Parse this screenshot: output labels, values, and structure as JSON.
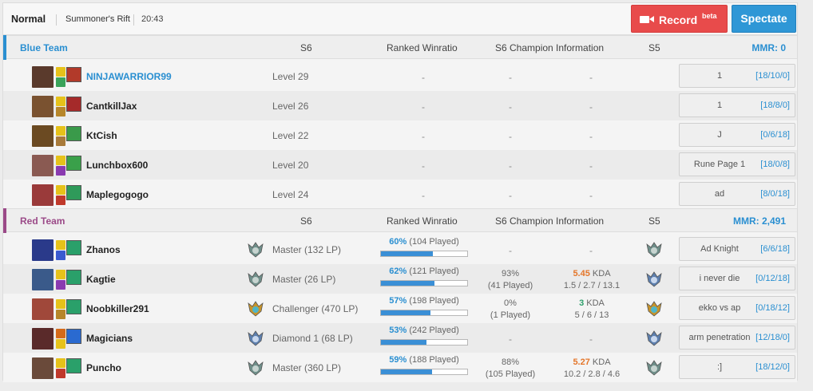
{
  "header": {
    "mode": "Normal",
    "map": "Summoner's Rift",
    "duration": "20:43",
    "record_label": "Record",
    "record_badge": "beta",
    "spectate_label": "Spectate"
  },
  "blue": {
    "name": "Blue Team",
    "columns": {
      "s6": "S6",
      "ranked": "Ranked Winratio",
      "champinfo": "S6 Champion Information",
      "s5": "S5"
    },
    "mmr": "MMR: 0",
    "color": "#2a8fd1",
    "players": [
      {
        "name": "NINJAWARRIOR99",
        "level": "Level 29",
        "ranked": "-",
        "champ_wr": "-",
        "kda": "-",
        "rune_page": "1",
        "rune_kda": "[18/10/0]",
        "highlight": true,
        "champ_color": "#5a3a2c",
        "spell1": "#e6c21a",
        "spell2": "#3aa35a",
        "rune": "#b23a2a"
      },
      {
        "name": "CantkillJax",
        "level": "Level 26",
        "ranked": "-",
        "champ_wr": "-",
        "kda": "-",
        "rune_page": "1",
        "rune_kda": "[18/8/0]",
        "champ_color": "#7a5230",
        "spell1": "#e6c21a",
        "spell2": "#b7862a",
        "rune": "#a52a2a"
      },
      {
        "name": "KtCish",
        "level": "Level 22",
        "ranked": "-",
        "champ_wr": "-",
        "kda": "-",
        "rune_page": "J",
        "rune_kda": "[0/6/18]",
        "champ_color": "#6b4a22",
        "spell1": "#e6c21a",
        "spell2": "#a87a3a",
        "rune": "#3a9a4a"
      },
      {
        "name": "Lunchbox600",
        "level": "Level 20",
        "ranked": "-",
        "champ_wr": "-",
        "kda": "-",
        "rune_page": "Rune Page 1",
        "rune_kda": "[18/0/8]",
        "champ_color": "#8a5a52",
        "spell1": "#e6c21a",
        "spell2": "#8a3ab0",
        "rune": "#3aa04a"
      },
      {
        "name": "Maplegogogo",
        "level": "Level 24",
        "ranked": "-",
        "champ_wr": "-",
        "kda": "-",
        "rune_page": "ad",
        "rune_kda": "[8/0/18]",
        "champ_color": "#9a3a3a",
        "spell1": "#e6c21a",
        "spell2": "#c0392b",
        "rune": "#2f9a5a"
      }
    ]
  },
  "red": {
    "name": "Red Team",
    "columns": {
      "s6": "S6",
      "ranked": "Ranked Winratio",
      "champinfo": "S6 Champion Information",
      "s5": "S5"
    },
    "mmr": "MMR: 2,491",
    "color": "#9b4a88",
    "players": [
      {
        "name": "Zhanos",
        "tier": "master",
        "rank": "Master (132 LP)",
        "wr_pct": "60%",
        "wr_played": "(104 Played)",
        "wr_fraction": 0.6,
        "champ_wr": "-",
        "champ_played": "",
        "kda_val": "-",
        "kda_unit": "",
        "kda_line": "",
        "s5_tier": "master",
        "rune_page": "Ad Knight",
        "rune_kda": "[6/6/18]",
        "champ_color": "#2a3a8a",
        "spell1": "#e6c21a",
        "spell2": "#3a5ad0",
        "rune": "#2aa06a"
      },
      {
        "name": "Kagtie",
        "tier": "master",
        "rank": "Master (26 LP)",
        "wr_pct": "62%",
        "wr_played": "(121 Played)",
        "wr_fraction": 0.62,
        "champ_wr": "93%",
        "champ_played": "(41 Played)",
        "kda_val": "5.45",
        "kda_unit": "KDA",
        "kda_color": "orange",
        "kda_line": "1.5 / 2.7 / 13.1",
        "s5_tier": "diamond",
        "rune_page": "i never die",
        "rune_kda": "[0/12/18]",
        "champ_color": "#3a5a8a",
        "spell1": "#e6c21a",
        "spell2": "#8a3ab0",
        "rune": "#2aa06a"
      },
      {
        "name": "Noobkiller291",
        "tier": "challenger",
        "rank": "Challenger (470 LP)",
        "wr_pct": "57%",
        "wr_played": "(198 Played)",
        "wr_fraction": 0.57,
        "champ_wr": "0%",
        "champ_played": "(1 Played)",
        "kda_val": "3",
        "kda_unit": "KDA",
        "kda_color": "green",
        "kda_line": "5 / 6 / 13",
        "s5_tier": "challenger",
        "rune_page": "ekko vs ap",
        "rune_kda": "[0/18/12]",
        "champ_color": "#a0483a",
        "spell1": "#e6c21a",
        "spell2": "#b7862a",
        "rune": "#2aa06a"
      },
      {
        "name": "Magicians",
        "tier": "diamond",
        "rank": "Diamond 1 (68 LP)",
        "wr_pct": "53%",
        "wr_played": "(242 Played)",
        "wr_fraction": 0.53,
        "champ_wr": "-",
        "champ_played": "",
        "kda_val": "-",
        "kda_unit": "",
        "kda_line": "",
        "s5_tier": "diamond",
        "rune_page": "arm penetration",
        "rune_kda": "[12/18/0]",
        "champ_color": "#5a2a2a",
        "spell1": "#d46a1a",
        "spell2": "#e6c21a",
        "rune": "#2a6ad0"
      },
      {
        "name": "Puncho",
        "tier": "master",
        "rank": "Master (360 LP)",
        "wr_pct": "59%",
        "wr_played": "(188 Played)",
        "wr_fraction": 0.59,
        "champ_wr": "88%",
        "champ_played": "(105 Played)",
        "kda_val": "5.27",
        "kda_unit": "KDA",
        "kda_color": "orange",
        "kda_line": "10.2 / 2.8 / 4.6",
        "s5_tier": "master",
        "rune_page": ":]",
        "rune_kda": "[18/12/0]",
        "champ_color": "#6a4a3a",
        "spell1": "#e6c21a",
        "spell2": "#c0392b",
        "rune": "#2aa06a"
      }
    ]
  }
}
